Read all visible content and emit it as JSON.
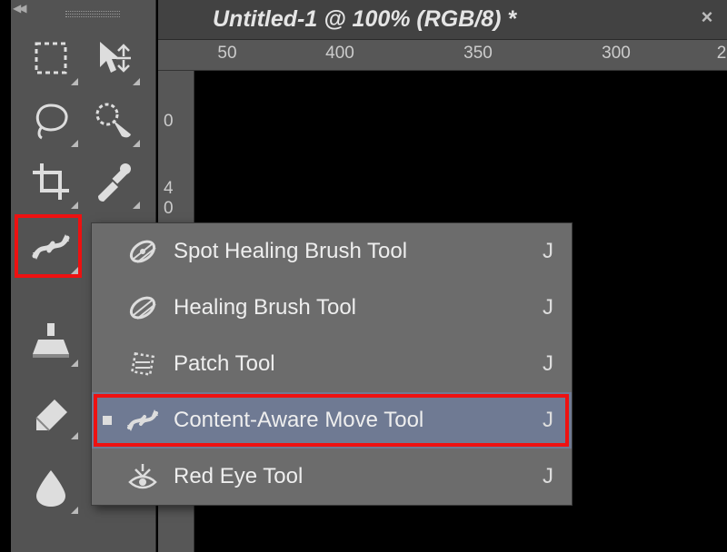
{
  "titlebar": {
    "text": "Untitled-1 @ 100% (RGB/8) *"
  },
  "ruler_h": [
    "50",
    "400",
    "350",
    "300",
    "2"
  ],
  "ruler_v": [
    "0",
    "4",
    "0"
  ],
  "flyout": {
    "items": [
      {
        "label": "Spot Healing Brush Tool",
        "shortcut": "J"
      },
      {
        "label": "Healing Brush Tool",
        "shortcut": "J"
      },
      {
        "label": "Patch Tool",
        "shortcut": "J"
      },
      {
        "label": "Content-Aware Move Tool",
        "shortcut": "J"
      },
      {
        "label": "Red Eye Tool",
        "shortcut": "J"
      }
    ]
  }
}
